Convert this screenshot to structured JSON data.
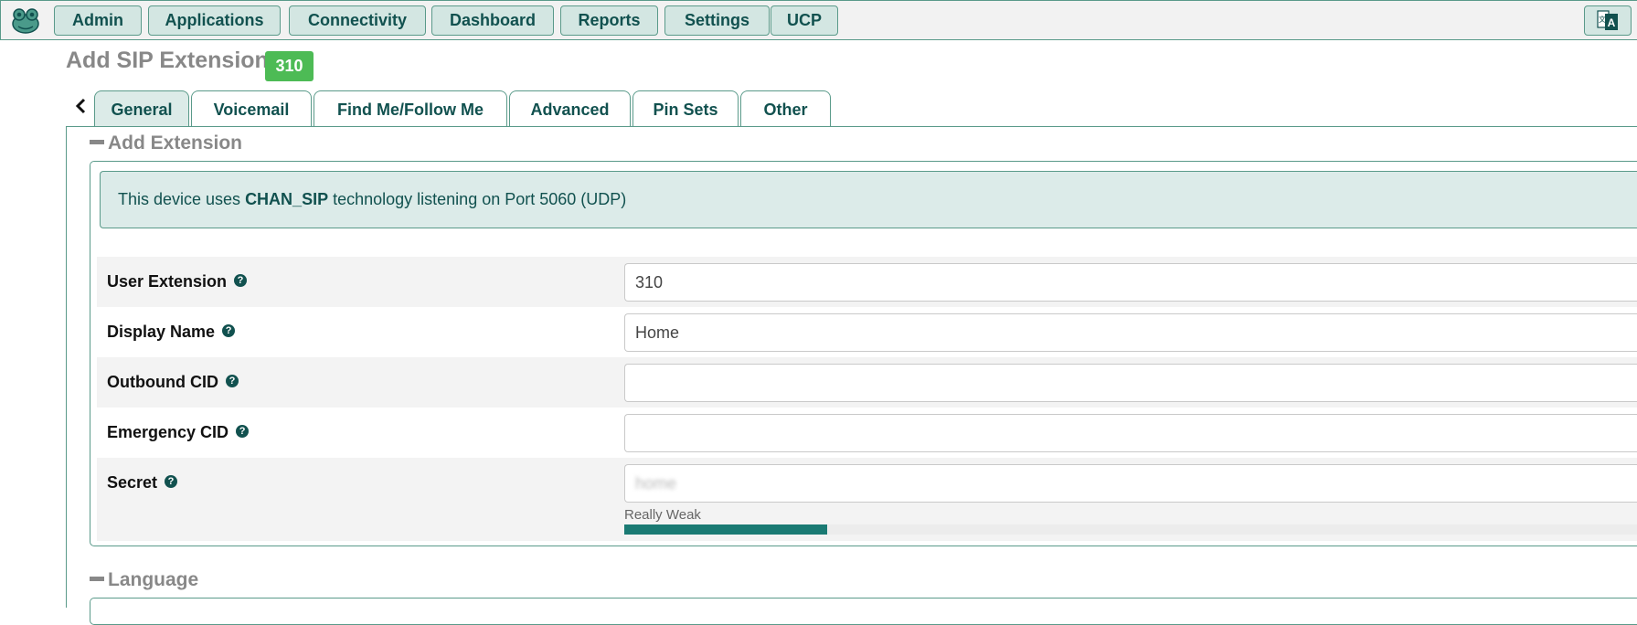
{
  "nav": {
    "items": [
      "Admin",
      "Applications",
      "Connectivity",
      "Dashboard",
      "Reports",
      "Settings",
      "UCP"
    ]
  },
  "page": {
    "title": "Add SIP Extension",
    "extension_badge": "310"
  },
  "tabs": [
    {
      "label": "General",
      "active": true
    },
    {
      "label": "Voicemail",
      "active": false
    },
    {
      "label": "Find Me/Follow Me",
      "active": false
    },
    {
      "label": "Advanced",
      "active": false
    },
    {
      "label": "Pin Sets",
      "active": false
    },
    {
      "label": "Other",
      "active": false
    }
  ],
  "section_add_extension": {
    "title": "Add Extension",
    "info": {
      "prefix": "This device uses ",
      "tech": "CHAN_SIP",
      "suffix": " technology listening on Port 5060 (UDP)"
    },
    "fields": [
      {
        "label": "User Extension",
        "value": "310"
      },
      {
        "label": "Display Name",
        "value": "Home"
      },
      {
        "label": "Outbound CID",
        "value": ""
      },
      {
        "label": "Emergency CID",
        "value": ""
      },
      {
        "label": "Secret",
        "value": "home"
      }
    ],
    "secret_strength": {
      "label": "Really Weak",
      "fraction": 0.2
    }
  },
  "section_language": {
    "title": "Language"
  },
  "colors": {
    "accent": "#11514f",
    "badge": "#4dbb55",
    "strength_fill": "#1a7a73"
  }
}
